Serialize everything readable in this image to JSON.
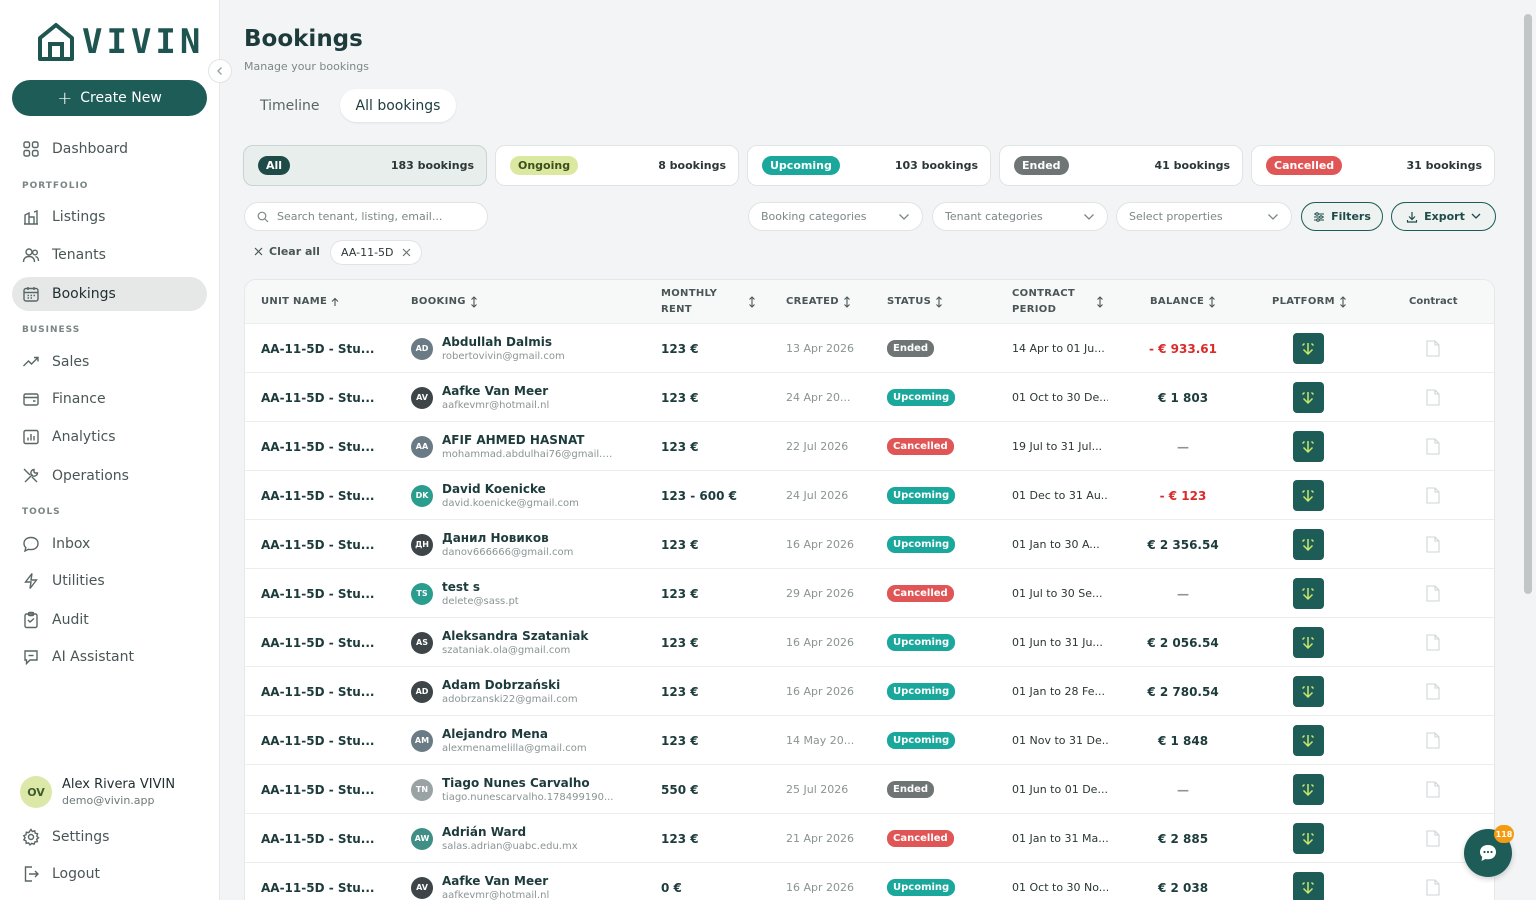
{
  "app": {
    "logo_text": "VIVIN"
  },
  "sidebar": {
    "create_label": "Create New",
    "dashboard": "Dashboard",
    "section_portfolio": "PORTFOLIO",
    "listings": "Listings",
    "tenants": "Tenants",
    "bookings": "Bookings",
    "section_business": "BUSINESS",
    "sales": "Sales",
    "finance": "Finance",
    "analytics": "Analytics",
    "operations": "Operations",
    "section_tools": "TOOLS",
    "inbox": "Inbox",
    "utilities": "Utilities",
    "audit": "Audit",
    "ai_assistant": "AI Assistant",
    "settings": "Settings",
    "logout": "Logout",
    "user": {
      "initials": "OV",
      "name": "Alex Rivera VIVIN",
      "email": "demo@vivin.app"
    }
  },
  "header": {
    "title": "Bookings",
    "subtitle": "Manage your bookings"
  },
  "view_tabs": [
    {
      "label": "Timeline"
    },
    {
      "label": "All bookings"
    }
  ],
  "stats": [
    {
      "label": "All",
      "count": "183 bookings",
      "bg": "#1e4a48",
      "fg": "#ffffff"
    },
    {
      "label": "Ongoing",
      "count": "8 bookings",
      "bg": "#dbe8a0",
      "fg": "#3d4d1c"
    },
    {
      "label": "Upcoming",
      "count": "103 bookings",
      "bg": "#1aa79c",
      "fg": "#ffffff"
    },
    {
      "label": "Ended",
      "count": "41 bookings",
      "bg": "#6f7575",
      "fg": "#ffffff"
    },
    {
      "label": "Cancelled",
      "count": "31 bookings",
      "bg": "#e05555",
      "fg": "#ffffff"
    }
  ],
  "filters": {
    "search_placeholder": "Search tenant, listing, email...",
    "booking_categories": "Booking categories",
    "tenant_categories": "Tenant categories",
    "select_properties": "Select properties",
    "filters_label": "Filters",
    "export_label": "Export",
    "clear_all": "Clear all",
    "chip": "AA-11-5D"
  },
  "table": {
    "headers": {
      "unit": "UNIT NAME",
      "booking": "BOOKING",
      "rent_1": "MONTHLY",
      "rent_2": "RENT",
      "created": "CREATED",
      "status": "STATUS",
      "period_1": "CONTRACT",
      "period_2": "PERIOD",
      "balance": "BALANCE",
      "platform": "PLATFORM",
      "contract": "Contract"
    },
    "rows": [
      {
        "unit": "AA-11-5D - Stu...",
        "initials": "AD",
        "avatar": "#6b7b85",
        "name": "Abdullah Dalmis",
        "email": "robertovivin@gmail.com",
        "rent": "123 €",
        "created": "13 Apr 2026",
        "status": "Ended",
        "status_color": "#6f7575",
        "period": "14 Apr to 01 Ju...",
        "balance": "- € 933.61",
        "balance_color": "#d92b2b"
      },
      {
        "unit": "AA-11-5D - Stu...",
        "initials": "AV",
        "avatar": "#3d4548",
        "name": "Aafke Van Meer",
        "email": "aafkevmr@hotmail.nl",
        "rent": "123 €",
        "created": "24 Apr 20...",
        "status": "Upcoming",
        "status_color": "#1aa79c",
        "period": "01 Oct to 30 De...",
        "balance": "€ 1 803",
        "balance_color": "#1e3b3c"
      },
      {
        "unit": "AA-11-5D - Stu...",
        "initials": "AA",
        "avatar": "#6b7b85",
        "name": "AFIF AHMED HASNAT",
        "email": "mohammad.abdulhai76@gmail.c...",
        "rent": "123 €",
        "created": "22 Jul 2026",
        "status": "Cancelled",
        "status_color": "#e05555",
        "period": "19 Jul to 31 Jul...",
        "balance": "—",
        "balance_color": "#8a9494"
      },
      {
        "unit": "AA-11-5D - Stu...",
        "initials": "DK",
        "avatar": "#2a9d8f",
        "name": "David Koenicke",
        "email": "david.koenicke@gmail.com",
        "rent": "123 - 600 €",
        "created": "24 Jul 2026",
        "status": "Upcoming",
        "status_color": "#1aa79c",
        "period": "01 Dec to 31 Au...",
        "balance": "- € 123",
        "balance_color": "#d92b2b"
      },
      {
        "unit": "AA-11-5D - Stu...",
        "initials": "ДН",
        "avatar": "#3d4548",
        "name": "Данил Новиков",
        "email": "danov666666@gmail.com",
        "rent": "123 €",
        "created": "16 Apr 2026",
        "status": "Upcoming",
        "status_color": "#1aa79c",
        "period": "01 Jan to 30 A...",
        "balance": "€ 2 356.54",
        "balance_color": "#1e3b3c"
      },
      {
        "unit": "AA-11-5D - Stu...",
        "initials": "TS",
        "avatar": "#2a9d8f",
        "name": "test s",
        "email": "delete@sass.pt",
        "rent": "123 €",
        "created": "29 Apr 2026",
        "status": "Cancelled",
        "status_color": "#e05555",
        "period": "01 Jul to 30 Se...",
        "balance": "—",
        "balance_color": "#8a9494"
      },
      {
        "unit": "AA-11-5D - Stu...",
        "initials": "AS",
        "avatar": "#3d4548",
        "name": "Aleksandra Szataniak",
        "email": "szataniak.ola@gmail.com",
        "rent": "123 €",
        "created": "16 Apr 2026",
        "status": "Upcoming",
        "status_color": "#1aa79c",
        "period": "01 Jun to 31 Ju...",
        "balance": "€ 2 056.54",
        "balance_color": "#1e3b3c"
      },
      {
        "unit": "AA-11-5D - Stu...",
        "initials": "AD",
        "avatar": "#3d4548",
        "name": "Adam Dobrzański",
        "email": "adobrzanski22@gmail.com",
        "rent": "123 €",
        "created": "16 Apr 2026",
        "status": "Upcoming",
        "status_color": "#1aa79c",
        "period": "01 Jan to 28 Fe...",
        "balance": "€ 2 780.54",
        "balance_color": "#1e3b3c"
      },
      {
        "unit": "AA-11-5D - Stu...",
        "initials": "AM",
        "avatar": "#6b7b85",
        "name": "Alejandro Mena",
        "email": "alexmenamelilla@gmail.com",
        "rent": "123 €",
        "created": "14 May 20...",
        "status": "Upcoming",
        "status_color": "#1aa79c",
        "period": "01 Nov to 31 De...",
        "balance": "€ 1 848",
        "balance_color": "#1e3b3c"
      },
      {
        "unit": "AA-11-5D - Stu...",
        "initials": "TN",
        "avatar": "#9aa3a3",
        "name": "Tiago Nunes Carvalho",
        "email": "tiago.nunescarvalho.178499190...",
        "rent": "550 €",
        "created": "25 Jul 2026",
        "status": "Ended",
        "status_color": "#6f7575",
        "period": "01 Jun to 01 De...",
        "balance": "—",
        "balance_color": "#8a9494"
      },
      {
        "unit": "AA-11-5D - Stu...",
        "initials": "AW",
        "avatar": "#3f8f86",
        "name": "Adrián Ward",
        "email": "salas.adrian@uabc.edu.mx",
        "rent": "123 €",
        "created": "21 Apr 2026",
        "status": "Cancelled",
        "status_color": "#e05555",
        "period": "01 Jan to 31 Ma...",
        "balance": "€ 2 885",
        "balance_color": "#1e3b3c"
      },
      {
        "unit": "AA-11-5D - Stu...",
        "initials": "AV",
        "avatar": "#3d4548",
        "name": "Aafke Van Meer",
        "email": "aafkevmr@hotmail.nl",
        "rent": "0 €",
        "created": "16 Apr 2026",
        "status": "Upcoming",
        "status_color": "#1aa79c",
        "period": "01 Oct to 30 No...",
        "balance": "€ 2 038",
        "balance_color": "#1e3b3c"
      }
    ]
  },
  "chat": {
    "badge": "118"
  }
}
